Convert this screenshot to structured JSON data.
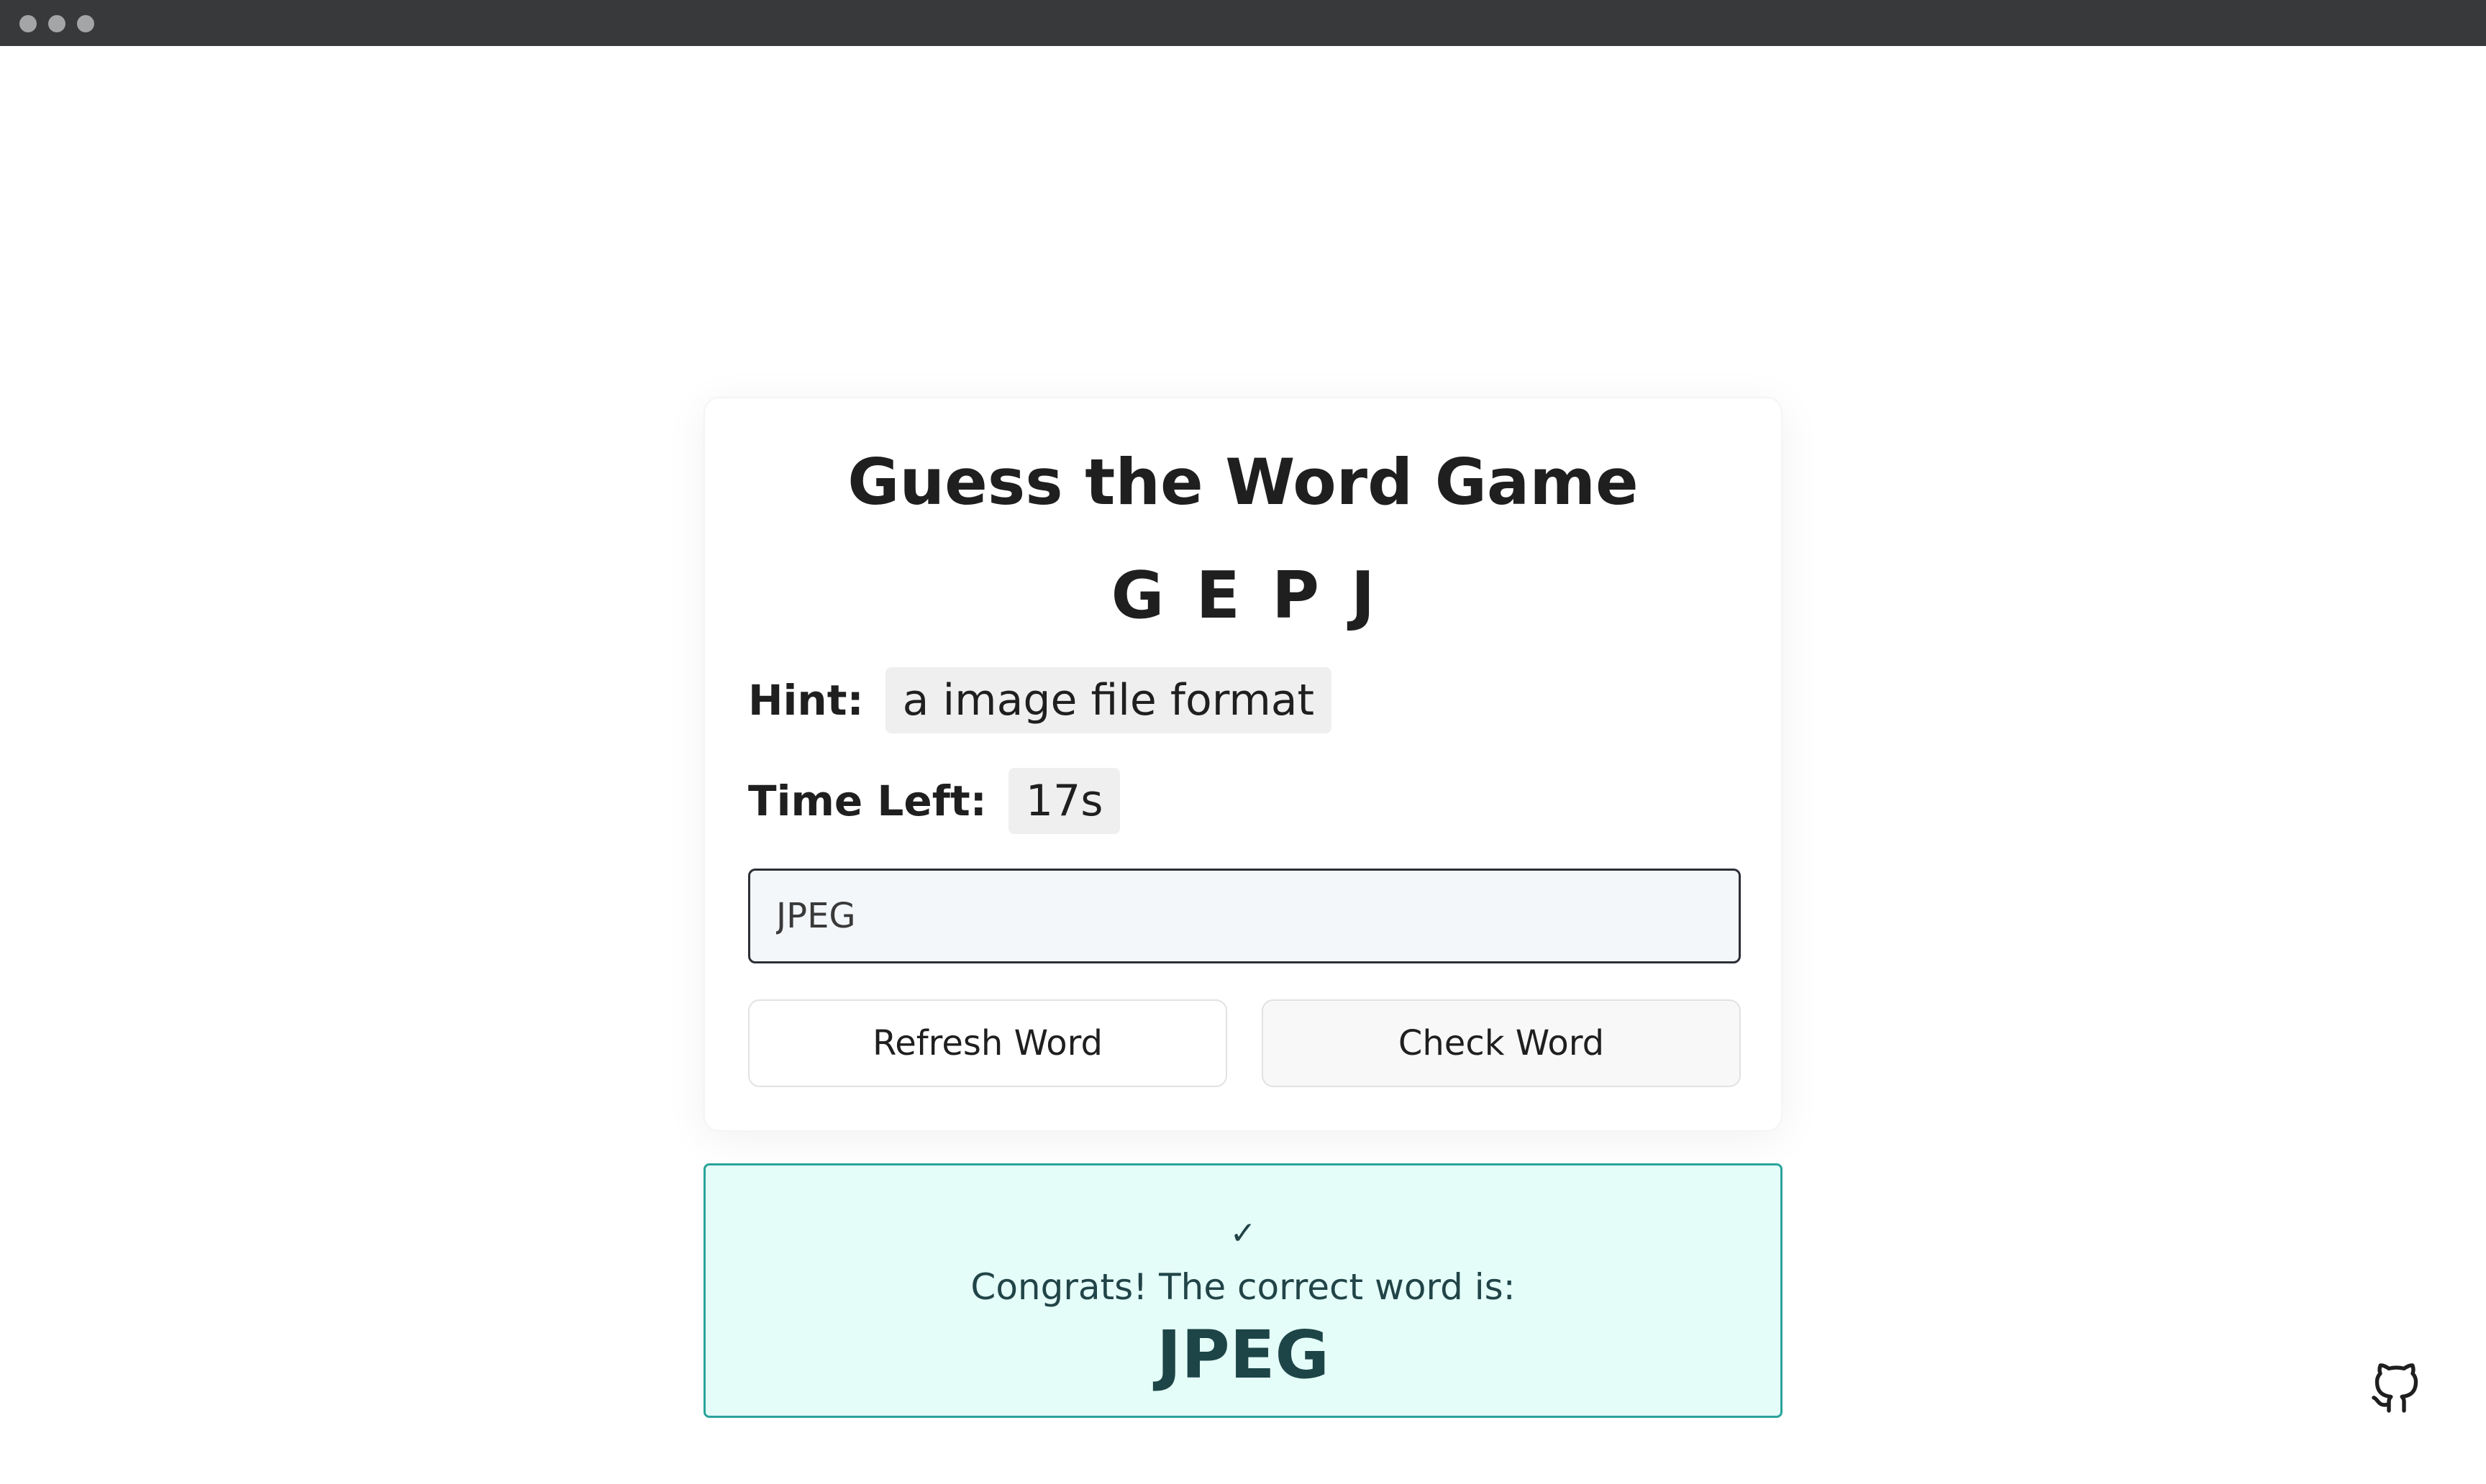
{
  "window": {
    "controls": [
      "close",
      "minimize",
      "maximize"
    ]
  },
  "game": {
    "title": "Guess the Word Game",
    "scrambled_letters": "GEPJ",
    "hint_label": "Hint:",
    "hint_value": "a image file format",
    "time_label": "Time Left:",
    "time_value": "17s",
    "input_value": "JPEG",
    "refresh_label": "Refresh Word",
    "check_label": "Check Word"
  },
  "result": {
    "icon": "checkmark-icon",
    "message": "Congrats! The correct word is:",
    "word": "JPEG"
  },
  "footer": {
    "icon": "github-icon"
  },
  "colors": {
    "titlebar": "#38393b",
    "result_background": "#e4fdf8",
    "result_border": "#2aa39b",
    "result_text": "#1d4548",
    "chip_background": "#efefef",
    "input_border": "#2c2f36"
  }
}
